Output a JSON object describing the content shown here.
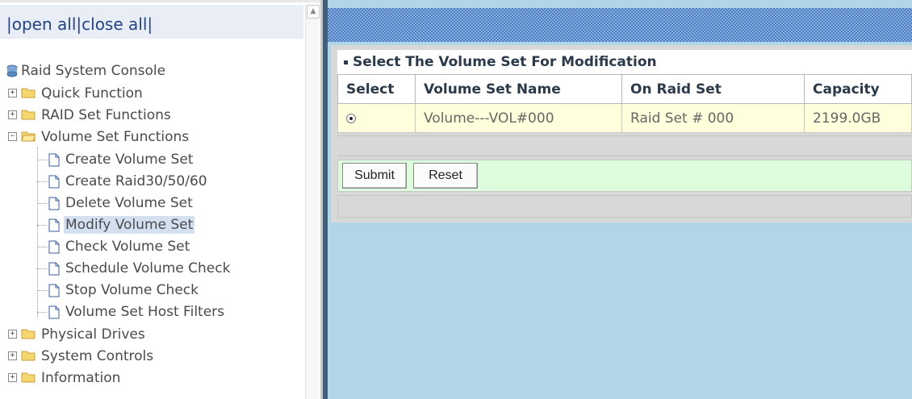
{
  "left_frame": {
    "open_all": "open all",
    "close_all": "close all",
    "separator": "|"
  },
  "tree": {
    "root": "Raid System Console",
    "items": [
      {
        "label": "Quick Function",
        "expanded": false
      },
      {
        "label": "RAID Set Functions",
        "expanded": false
      },
      {
        "label": "Volume Set Functions",
        "expanded": true,
        "children": [
          "Create Volume Set",
          "Create Raid30/50/60",
          "Delete Volume Set",
          "Modify Volume Set",
          "Check Volume Set",
          "Schedule Volume Check",
          "Stop Volume Check",
          "Volume Set Host Filters"
        ]
      },
      {
        "label": "Physical Drives",
        "expanded": false
      },
      {
        "label": "System Controls",
        "expanded": false
      },
      {
        "label": "Information",
        "expanded": false
      }
    ],
    "selected": "Modify Volume Set"
  },
  "panel": {
    "title": "Select The Volume Set For Modification",
    "columns": [
      "Select",
      "Volume Set Name",
      "On Raid Set",
      "Capacity"
    ],
    "rows": [
      {
        "selected": true,
        "name": "Volume---VOL#000",
        "raid_set": "Raid Set # 000",
        "capacity": "2199.0GB"
      }
    ],
    "submit_label": "Submit",
    "reset_label": "Reset"
  },
  "colors": {
    "tree_text": "#4a4a4a",
    "link": "#224488",
    "right_bg": "#b0d6e8",
    "table_row_bg": "#ffffdc",
    "button_row_bg": "#dcfcdc"
  }
}
